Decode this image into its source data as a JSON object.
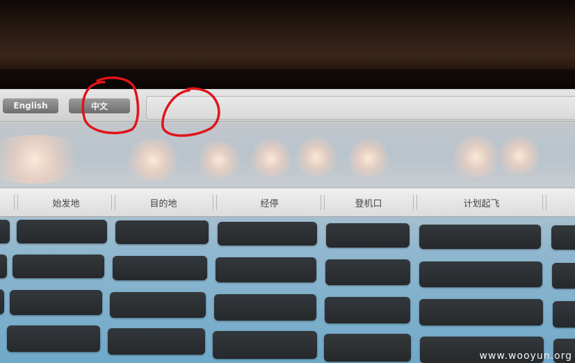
{
  "language_bar": {
    "english_label": "English",
    "chinese_label": "中文",
    "input_value": ""
  },
  "table": {
    "headers": [
      "始发地",
      "目的地",
      "经停",
      "登机口",
      "计划起飞"
    ],
    "rows": [
      [
        "",
        "",
        "",
        "",
        ""
      ],
      [
        "",
        "",
        "",
        "",
        ""
      ],
      [
        "",
        "",
        "",
        "",
        ""
      ],
      [
        "",
        "",
        "",
        "",
        ""
      ]
    ]
  },
  "watermark": "www.wooyun.org",
  "colors": {
    "annotation": "#e0141a",
    "cell": "#2a2e31",
    "screen_blue": "#6fa9c9"
  }
}
